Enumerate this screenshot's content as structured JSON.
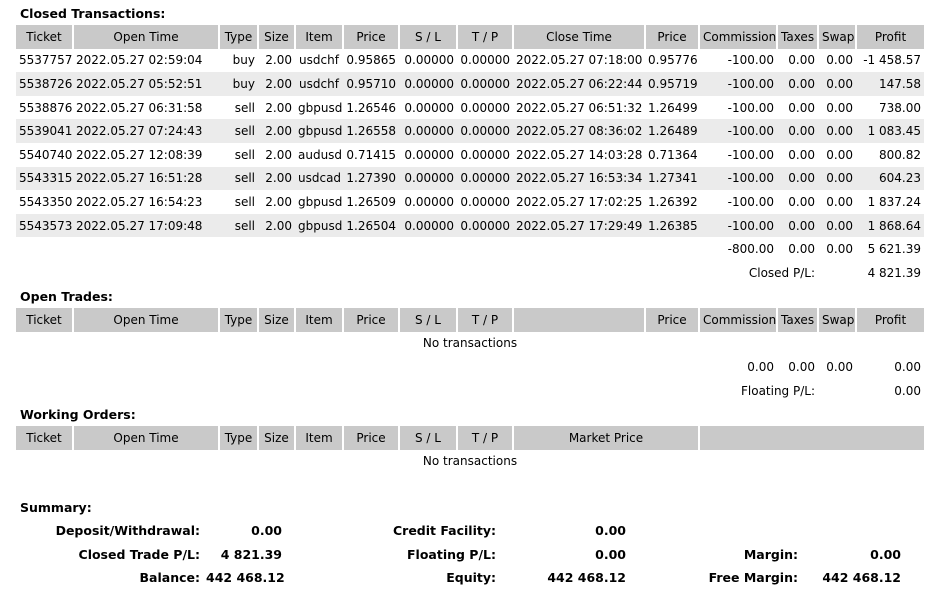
{
  "closed": {
    "title": "Closed Transactions:",
    "headers": [
      "Ticket",
      "Open Time",
      "Type",
      "Size",
      "Item",
      "Price",
      "S / L",
      "T / P",
      "Close Time",
      "Price",
      "Commission",
      "Taxes",
      "Swap",
      "Profit"
    ],
    "rows": [
      [
        "5537757",
        "2022.05.27 02:59:04",
        "buy",
        "2.00",
        "usdchf",
        "0.95865",
        "0.00000",
        "0.00000",
        "2022.05.27 07:18:00",
        "0.95776",
        "-100.00",
        "0.00",
        "0.00",
        "-1 458.57"
      ],
      [
        "5538726",
        "2022.05.27 05:52:51",
        "buy",
        "2.00",
        "usdchf",
        "0.95710",
        "0.00000",
        "0.00000",
        "2022.05.27 06:22:44",
        "0.95719",
        "-100.00",
        "0.00",
        "0.00",
        "147.58"
      ],
      [
        "5538876",
        "2022.05.27 06:31:58",
        "sell",
        "2.00",
        "gbpusd",
        "1.26546",
        "0.00000",
        "0.00000",
        "2022.05.27 06:51:32",
        "1.26499",
        "-100.00",
        "0.00",
        "0.00",
        "738.00"
      ],
      [
        "5539041",
        "2022.05.27 07:24:43",
        "sell",
        "2.00",
        "gbpusd",
        "1.26558",
        "0.00000",
        "0.00000",
        "2022.05.27 08:36:02",
        "1.26489",
        "-100.00",
        "0.00",
        "0.00",
        "1 083.45"
      ],
      [
        "5540740",
        "2022.05.27 12:08:39",
        "sell",
        "2.00",
        "audusd",
        "0.71415",
        "0.00000",
        "0.00000",
        "2022.05.27 14:03:28",
        "0.71364",
        "-100.00",
        "0.00",
        "0.00",
        "800.82"
      ],
      [
        "5543315",
        "2022.05.27 16:51:28",
        "sell",
        "2.00",
        "usdcad",
        "1.27390",
        "0.00000",
        "0.00000",
        "2022.05.27 16:53:34",
        "1.27341",
        "-100.00",
        "0.00",
        "0.00",
        "604.23"
      ],
      [
        "5543350",
        "2022.05.27 16:54:23",
        "sell",
        "2.00",
        "gbpusd",
        "1.26509",
        "0.00000",
        "0.00000",
        "2022.05.27 17:02:25",
        "1.26392",
        "-100.00",
        "0.00",
        "0.00",
        "1 837.24"
      ],
      [
        "5543573",
        "2022.05.27 17:09:48",
        "sell",
        "2.00",
        "gbpusd",
        "1.26504",
        "0.00000",
        "0.00000",
        "2022.05.27 17:29:49",
        "1.26385",
        "-100.00",
        "0.00",
        "0.00",
        "1 868.64"
      ]
    ],
    "totals": {
      "commission": "-800.00",
      "taxes": "0.00",
      "swap": "0.00",
      "profit": "5 621.39"
    },
    "pl_label": "Closed P/L:",
    "pl_value": "4 821.39"
  },
  "open": {
    "title": "Open Trades:",
    "headers": [
      "Ticket",
      "Open Time",
      "Type",
      "Size",
      "Item",
      "Price",
      "S / L",
      "T / P",
      "",
      "Price",
      "Commission",
      "Taxes",
      "Swap",
      "Profit"
    ],
    "empty_text": "No transactions",
    "totals": {
      "commission": "0.00",
      "taxes": "0.00",
      "swap": "0.00",
      "profit": "0.00"
    },
    "pl_label": "Floating P/L:",
    "pl_value": "0.00"
  },
  "working": {
    "title": "Working Orders:",
    "headers": [
      "Ticket",
      "Open Time",
      "Type",
      "Size",
      "Item",
      "Price",
      "S / L",
      "T / P",
      "Market Price",
      ""
    ],
    "empty_text": "No transactions"
  },
  "summary": {
    "title": "Summary:",
    "deposit_label": "Deposit/Withdrawal:",
    "deposit_value": "0.00",
    "credit_label": "Credit Facility:",
    "credit_value": "0.00",
    "closed_pl_label": "Closed Trade P/L:",
    "closed_pl_value": "4 821.39",
    "floating_pl_label": "Floating P/L:",
    "floating_pl_value": "0.00",
    "margin_label": "Margin:",
    "margin_value": "0.00",
    "balance_label": "Balance:",
    "balance_value": "442 468.12",
    "equity_label": "Equity:",
    "equity_value": "442 468.12",
    "free_margin_label": "Free Margin:",
    "free_margin_value": "442 468.12"
  }
}
